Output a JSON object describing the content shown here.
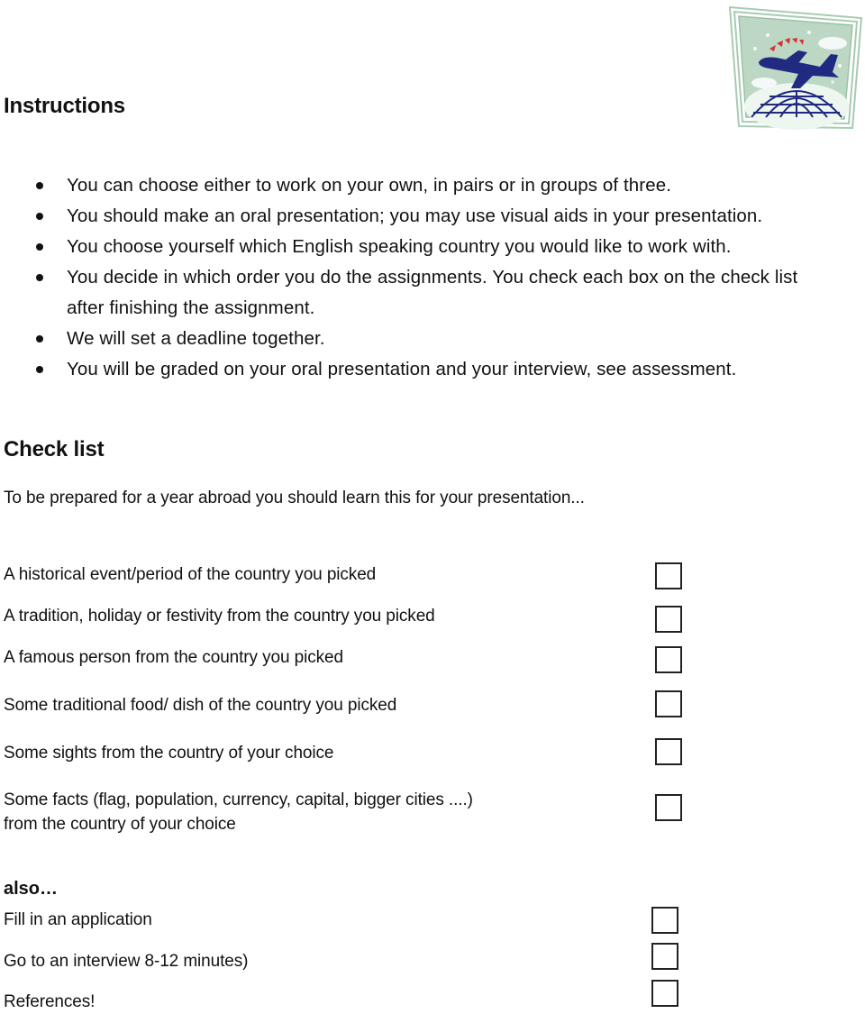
{
  "instructions": {
    "title": "Instructions",
    "bullets": [
      "You can choose either to work on your own, in pairs or in groups of three.",
      "You should make an oral presentation; you may use visual aids in your presentation.",
      "You choose yourself which English speaking country you would like to work with.",
      "You decide in which order you do the assignments. You check each box on the check list after finishing the assignment.",
      "We will set a deadline together.",
      "You will be graded on your oral presentation and your interview, see assessment."
    ]
  },
  "checklist": {
    "title": "Check list",
    "intro": "To be prepared for a year abroad you should learn this for your presentation...",
    "items": [
      {
        "label": "A historical event/period of the country you picked",
        "checked": false
      },
      {
        "label": "A tradition, holiday or festivity from the country you picked",
        "checked": false
      },
      {
        "label": "A famous person from the country you picked",
        "checked": false
      },
      {
        "label": "Some traditional food/ dish of the country you picked",
        "checked": false
      },
      {
        "label": "Some sights from the country of your choice",
        "checked": false
      },
      {
        "label": "Some facts (flag, population, currency, capital, bigger cities ....)",
        "label2": "from the country of your choice",
        "checked": false
      }
    ]
  },
  "also": {
    "title": "also…",
    "items": [
      {
        "label": "Fill in an application",
        "checked": false
      },
      {
        "label": "Go to an interview 8-12 minutes)",
        "checked": false
      },
      {
        "label": "References!",
        "checked": false
      }
    ]
  },
  "logo": {
    "icon": "airplane-globe-icon",
    "colors": {
      "background": "#bcd8c4",
      "plane": "#1f2a80",
      "globe": "#1f2a80",
      "triangles": "#d83030"
    }
  }
}
